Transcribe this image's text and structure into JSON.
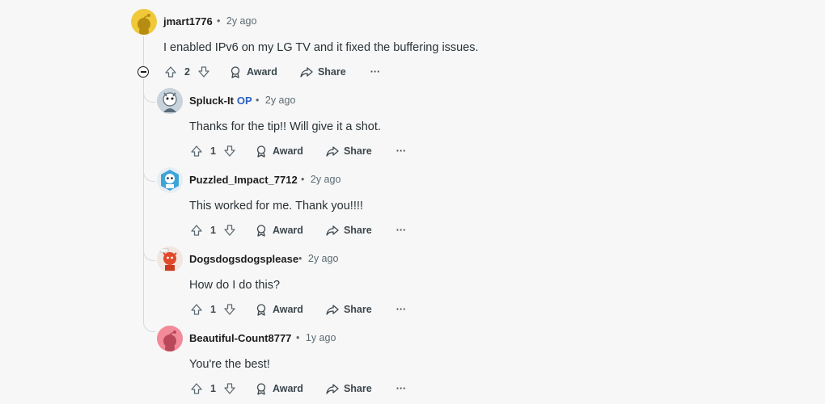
{
  "comments": [
    {
      "username": "jmart1776",
      "op": "",
      "sep": "•",
      "time": "2y ago",
      "text": "I enabled IPv6 on my LG TV and it fixed the buffering issues.",
      "votes": "2",
      "award": "Award",
      "share": "Share",
      "more": "···",
      "avatar": {
        "bg": "#f0c93a",
        "fg": "#b78c12",
        "icon": "snoo-avatar-icon"
      }
    },
    {
      "username": "Spluck-It",
      "op": "OP",
      "sep": "•",
      "time": "2y ago",
      "text": "Thanks for the tip!! Will give it a shot.",
      "votes": "1",
      "award": "Award",
      "share": "Share",
      "more": "···",
      "avatar": {
        "bg": "#c9d3dc",
        "fg": "#5a6b78",
        "icon": "snoo-avatar-icon"
      }
    },
    {
      "username": "Puzzled_Impact_7712",
      "op": "",
      "sep": "•",
      "time": "2y ago",
      "text": "This worked for me. Thank you!!!!",
      "votes": "1",
      "award": "Award",
      "share": "Share",
      "more": "···",
      "avatar": {
        "bg": "#3da4d8",
        "fg": "#ffffff",
        "icon": "snoo-avatar-icon"
      }
    },
    {
      "username": "Dogsdogsdogsplease",
      "op": "",
      "sep": "•",
      "time": "2y ago",
      "text": "How do I do this?",
      "votes": "1",
      "award": "Award",
      "share": "Share",
      "more": "···",
      "avatar": {
        "bg": "#e04a2a",
        "fg": "#ffffff",
        "icon": "snoo-avatar-icon"
      }
    },
    {
      "username": "Beautiful-Count8777",
      "op": "",
      "sep": "•",
      "time": "1y ago",
      "text": "You're the best!",
      "votes": "1",
      "award": "Award",
      "share": "Share",
      "more": "···",
      "avatar": {
        "bg": "#f28a9a",
        "fg": "#b8485a",
        "icon": "snoo-avatar-icon"
      }
    }
  ],
  "colors": {
    "background": "#f7f7f8",
    "op_badge": "#2a5fbf",
    "meta_text": "#5c6b73",
    "thread_line": "#d6dadc"
  }
}
